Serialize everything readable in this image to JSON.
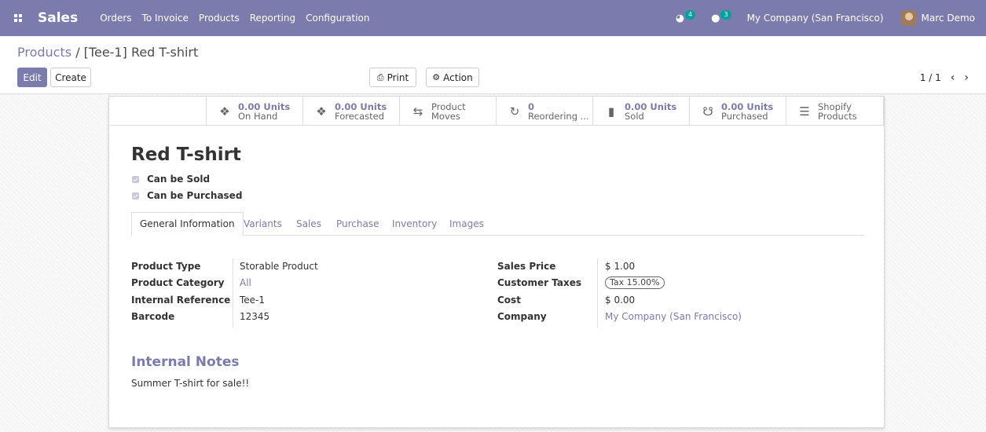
{
  "navbar": {
    "app_name": "Sales",
    "menu": [
      "Orders",
      "To Invoice",
      "Products",
      "Reporting",
      "Configuration"
    ],
    "activity_count": "4",
    "message_count": "3",
    "company": "My Company (San Francisco)",
    "user": "Marc Demo"
  },
  "breadcrumb": {
    "parent": "Products",
    "separator": "/",
    "current": "[Tee-1] Red T-shirt"
  },
  "toolbar": {
    "edit_label": "Edit",
    "create_label": "Create",
    "print_label": "Print",
    "action_label": "Action"
  },
  "pager": {
    "value": "1 / 1"
  },
  "smart_buttons": [
    {
      "value": "0.00 Units",
      "label": "On Hand",
      "icon": "cubes-icon"
    },
    {
      "value": "0.00 Units",
      "label": "Forecasted",
      "icon": "cubes-icon"
    },
    {
      "value": "Product",
      "label": "Moves",
      "icon": "exchange-icon"
    },
    {
      "value": "0",
      "label": "Reordering ...",
      "icon": "refresh-icon"
    },
    {
      "value": "0.00 Units",
      "label": "Sold",
      "icon": "signal-icon"
    },
    {
      "value": "0.00 Units",
      "label": "Purchased",
      "icon": "cart-icon"
    },
    {
      "value": "Shopify",
      "label": "Products",
      "icon": "list-icon"
    }
  ],
  "product": {
    "name": "Red T-shirt",
    "can_be_sold_label": "Can be Sold",
    "can_be_sold": true,
    "can_be_purchased_label": "Can be Purchased",
    "can_be_purchased": true
  },
  "tabs": [
    "General Information",
    "Variants",
    "Sales",
    "Purchase",
    "Inventory",
    "Images"
  ],
  "active_tab": "General Information",
  "fields_left": [
    {
      "label": "Product Type",
      "value": "Storable Product"
    },
    {
      "label": "Product Category",
      "value": "All"
    },
    {
      "label": "Internal Reference",
      "value": "Tee-1"
    },
    {
      "label": "Barcode",
      "value": "12345"
    }
  ],
  "fields_right": [
    {
      "label": "Sales Price",
      "value": "$ 1.00"
    },
    {
      "label": "Customer Taxes",
      "value": "Tax 15.00%"
    },
    {
      "label": "Cost",
      "value": "$ 0.00"
    },
    {
      "label": "Company",
      "value": "My Company (San Francisco)"
    }
  ],
  "notes": {
    "title": "Internal Notes",
    "text": "Summer T-shirt for sale!!"
  },
  "colors": {
    "brand": "#7c7bad",
    "badge": "#00a09d"
  }
}
